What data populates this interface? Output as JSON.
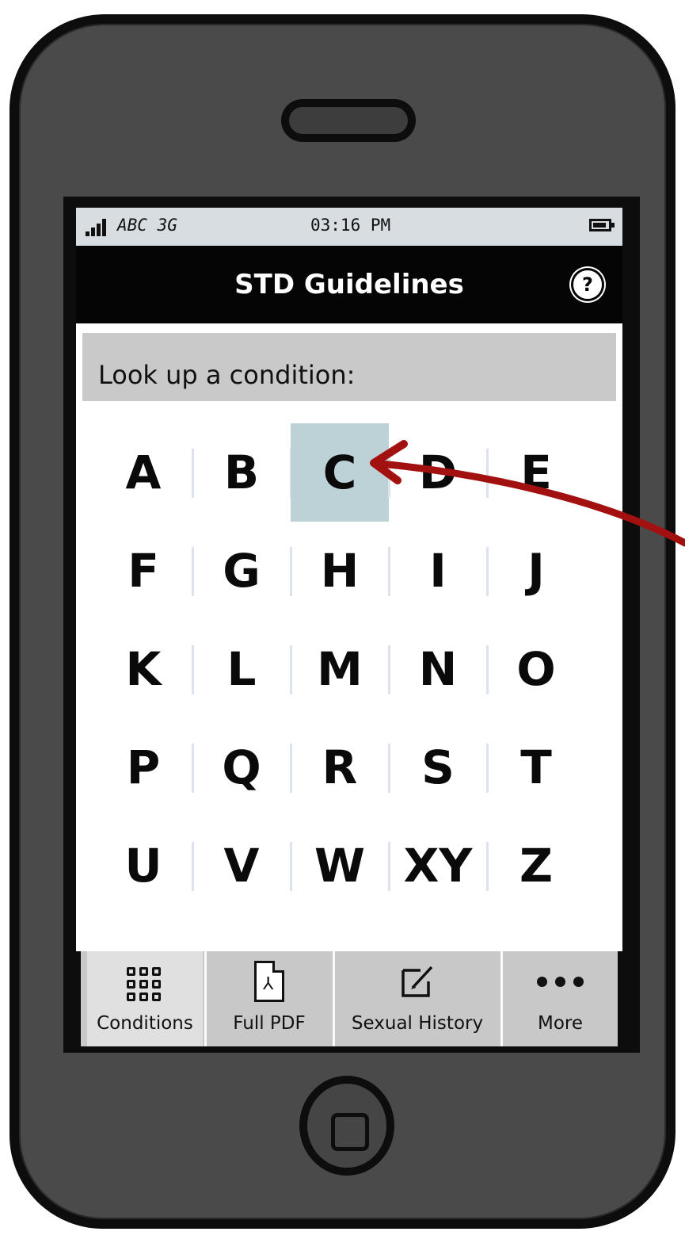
{
  "status_bar": {
    "carrier": "ABC 3G",
    "time": "03:16 PM"
  },
  "nav": {
    "title": "STD Guidelines",
    "help_label": "?"
  },
  "lookup": {
    "label": "Look up a condition:"
  },
  "letters": [
    "A",
    "B",
    "C",
    "D",
    "E",
    "F",
    "G",
    "H",
    "I",
    "J",
    "K",
    "L",
    "M",
    "N",
    "O",
    "P",
    "Q",
    "R",
    "S",
    "T",
    "U",
    "V",
    "W",
    "XY",
    "Z"
  ],
  "selected_letter": "C",
  "tabs": {
    "conditions": "Conditions",
    "full_pdf": "Full PDF",
    "sexual_history": "Sexual History",
    "more": "More"
  },
  "colors": {
    "selected_cell": "#bcd2d7",
    "annotation_arrow": "#a31010",
    "phone_body": "#4a4a4a"
  },
  "icons": {
    "signal": "signal-bars-icon",
    "battery": "battery-icon",
    "help": "help-circle-icon",
    "conditions": "grid-icon",
    "full_pdf": "pdf-document-icon",
    "sexual_history": "edit-icon",
    "more": "more-dots-icon"
  }
}
